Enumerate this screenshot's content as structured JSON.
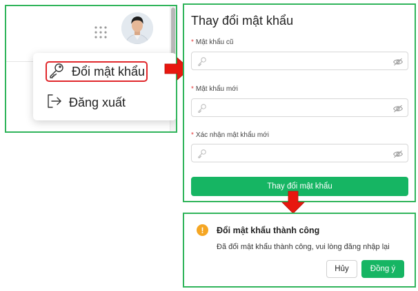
{
  "user_menu": {
    "items": [
      {
        "label": "Đổi mật khẩu",
        "icon": "key-icon"
      },
      {
        "label": "Đăng xuất",
        "icon": "logout-icon"
      }
    ]
  },
  "change_password_form": {
    "title": "Thay đổi mật khẩu",
    "fields": [
      {
        "label": "Mật khẩu cũ",
        "required_mark": "*",
        "value": ""
      },
      {
        "label": "Mật khẩu mới",
        "required_mark": "*",
        "value": ""
      },
      {
        "label": "Xác nhận mật khẩu mới",
        "required_mark": "*",
        "value": ""
      }
    ],
    "submit_label": "Thay đổi mật khẩu"
  },
  "success_dialog": {
    "icon_glyph": "!",
    "title": "Đổi mật khẩu thành công",
    "message": "Đã đổi mật khẩu thành công, vui lòng đăng nhập lại",
    "cancel_label": "Hủy",
    "confirm_label": "Đồng ý"
  },
  "colors": {
    "frame": "#2fb45a",
    "primary": "#16b563",
    "highlight": "#e0262a",
    "arrow": "#e8170f",
    "warning": "#f5a623",
    "required": "#e43b3b"
  }
}
